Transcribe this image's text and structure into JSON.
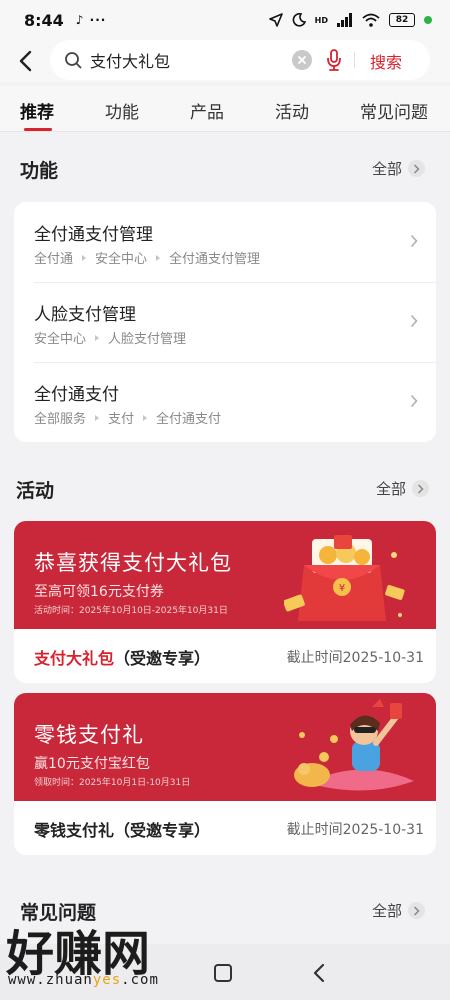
{
  "status_bar": {
    "time": "8:44",
    "extra_icons": "♪ ···",
    "network_label": "HD",
    "battery": "82"
  },
  "header": {
    "search_value": "支付大礼包",
    "search_button": "搜索"
  },
  "tabs": [
    {
      "label": "推荐",
      "active": true
    },
    {
      "label": "功能",
      "active": false
    },
    {
      "label": "产品",
      "active": false
    },
    {
      "label": "活动",
      "active": false
    },
    {
      "label": "常见问题",
      "active": false
    }
  ],
  "functions_section": {
    "title": "功能",
    "all_label": "全部",
    "items": [
      {
        "name": "全付通支付管理",
        "path": [
          "全付通",
          "安全中心",
          "全付通支付管理"
        ]
      },
      {
        "name": "人脸支付管理",
        "path": [
          "安全中心",
          "人脸支付管理"
        ]
      },
      {
        "name": "全付通支付",
        "path": [
          "全部服务",
          "支付",
          "全付通支付"
        ]
      }
    ]
  },
  "activities_section": {
    "title": "活动",
    "all_label": "全部",
    "items": [
      {
        "banner_title": "恭喜获得支付大礼包",
        "banner_subtitle": "至高可领16元支付券",
        "banner_time": "活动时间：2025年10月10日-2025年10月31日",
        "title_accent": "支付大礼包",
        "title_rest": "（受邀专享）",
        "deadline": "截止时间2025-10-31"
      },
      {
        "banner_title": "零钱支付礼",
        "banner_subtitle": "赢10元支付宝红包",
        "banner_time": "领取时间：2025年10月1日-10月31日",
        "title_accent": "",
        "title_rest": "零钱支付礼（受邀专享）",
        "deadline": "截止时间2025-10-31"
      }
    ]
  },
  "faq_section": {
    "title": "常见问题",
    "all_label": "全部"
  },
  "watermark": {
    "brand": "好赚网",
    "url_prefix": "www.zhuan",
    "url_highlight": "yes",
    "url_suffix": ".com"
  },
  "colors": {
    "accent": "#d8232e",
    "banner": "#c8283a",
    "background": "#f2f2f4"
  }
}
